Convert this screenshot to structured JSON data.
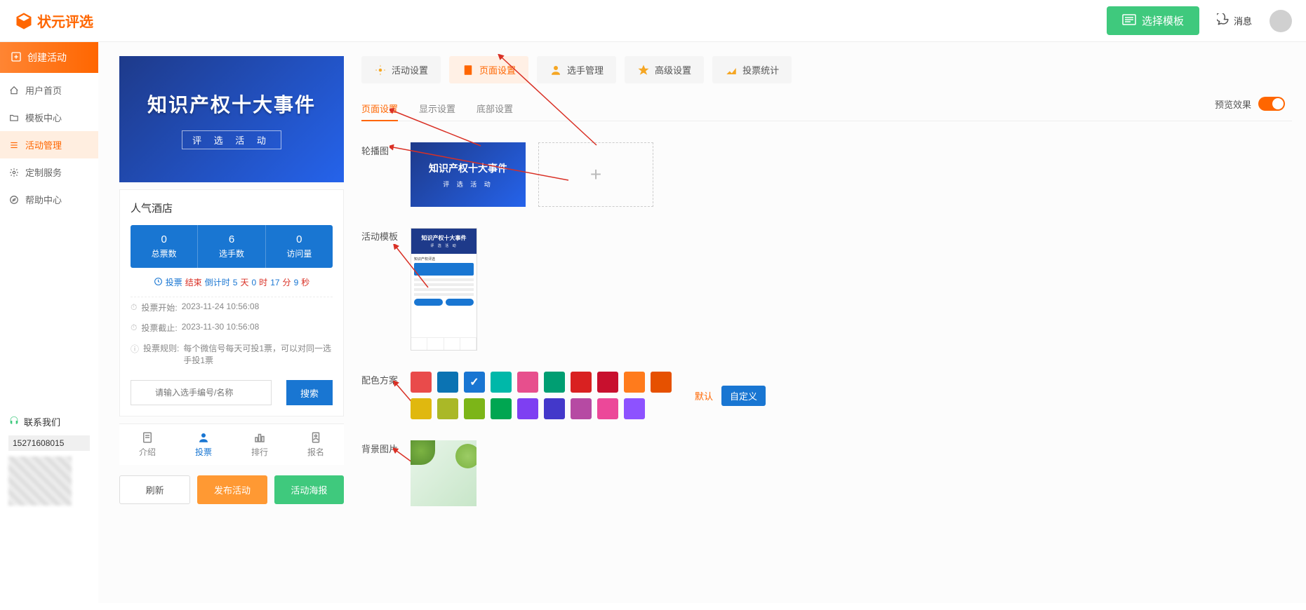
{
  "header": {
    "logo_text": "状元评选",
    "template_btn": "选择模板",
    "message": "消息"
  },
  "sidebar": {
    "create": "创建活动",
    "items": [
      {
        "label": "用户首页"
      },
      {
        "label": "模板中心"
      },
      {
        "label": "活动管理"
      },
      {
        "label": "定制服务"
      },
      {
        "label": "帮助中心"
      }
    ],
    "contact_title": "联系我们",
    "phone": "15271608015"
  },
  "preview": {
    "banner_title": "知识产权十大事件",
    "banner_sub": "评 选 活 动",
    "card_title": "人气酒店",
    "stats": [
      {
        "num": "0",
        "label": "总票数"
      },
      {
        "num": "6",
        "label": "选手数"
      },
      {
        "num": "0",
        "label": "访问量"
      }
    ],
    "countdown_prefix": "投票",
    "countdown_end": "结束",
    "countdown_label": "倒计时",
    "cd_d": "5",
    "cd_du": "天",
    "cd_h": "0",
    "cd_hu": "时",
    "cd_m": "17",
    "cd_mu": "分",
    "cd_s": "9",
    "cd_su": "秒",
    "info_start_label": "投票开始:",
    "info_start_val": "2023-11-24 10:56:08",
    "info_end_label": "投票截止:",
    "info_end_val": "2023-11-30 10:56:08",
    "info_rule_label": "投票规则:",
    "info_rule_val": "每个微信号每天可投1票，可以对同一选手投1票",
    "search_placeholder": "请输入选手编号/名称",
    "search_btn": "搜索",
    "bottom_nav": [
      {
        "label": "介绍"
      },
      {
        "label": "投票"
      },
      {
        "label": "排行"
      },
      {
        "label": "报名"
      }
    ],
    "btn_refresh": "刷新",
    "btn_publish": "发布活动",
    "btn_poster": "活动海报"
  },
  "settings": {
    "tabs": [
      {
        "label": "活动设置"
      },
      {
        "label": "页面设置"
      },
      {
        "label": "选手管理"
      },
      {
        "label": "高级设置"
      },
      {
        "label": "投票统计"
      }
    ],
    "preview_toggle_label": "预览效果",
    "sub_tabs": [
      {
        "label": "页面设置"
      },
      {
        "label": "显示设置"
      },
      {
        "label": "底部设置"
      }
    ],
    "row_carousel": "轮播图",
    "row_template": "活动模板",
    "row_colors": "配色方案",
    "row_bg": "背景图片",
    "carousel_title": "知识产权十大事件",
    "carousel_sub": "评 选 活 动",
    "color_default": "默认",
    "color_custom": "自定义",
    "colors_row1": [
      "#e94b4b",
      "#0b73b3",
      "#1976d2",
      "#00b8a9",
      "#e74f8d",
      "#009e72",
      "#d92121",
      "#c8102e",
      "#ff7b1c",
      "#e65100"
    ],
    "colors_row2": [
      "#e0b80f",
      "#aab827",
      "#7cb518",
      "#00a651",
      "#7e3ff2",
      "#4338ca",
      "#b64aa3",
      "#ec4899",
      "#8d52ff",
      ""
    ]
  }
}
